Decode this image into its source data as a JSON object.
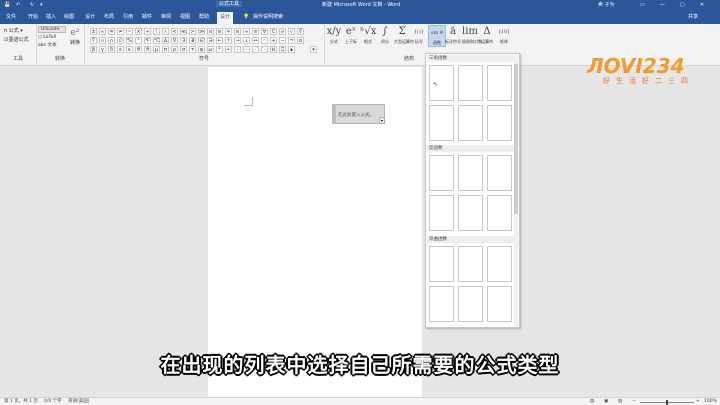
{
  "titlebar": {
    "doc_title": "新建 Microsoft Word 文档 - Word",
    "context_tab": "公式工具",
    "user": "卖 子为"
  },
  "tabs": [
    "文件",
    "开始",
    "插入",
    "绘图",
    "设计",
    "布局",
    "引用",
    "邮件",
    "审阅",
    "视图",
    "帮助",
    "设计"
  ],
  "tell_me": "操作说明搜索",
  "share": "共享",
  "ribbon": {
    "tools": {
      "equation": "公式",
      "ink": "墨迹公式",
      "label": "工具"
    },
    "conversions": {
      "unicode": "Unicode",
      "latex": "LaTeX",
      "text": "abc 文本",
      "convert": "转换",
      "label": "转换"
    },
    "symbols_label": "符号",
    "symbols": [
      "±",
      "∞",
      "=",
      "≠",
      "~",
      "×",
      "÷",
      "!",
      "∝",
      "<",
      "≪",
      ">",
      "≫",
      "≤",
      "≥",
      "∓",
      "≅",
      "≈",
      "≡",
      "∀",
      "∁",
      "∂",
      "√",
      "∛",
      "∜",
      "∪",
      "∩",
      "∅",
      "%",
      "°",
      "℉",
      "℃",
      "∆",
      "∇",
      "∃",
      "∄",
      "∈",
      "∋",
      "←",
      "↑",
      "→",
      "↓",
      "↔",
      "∴",
      "+",
      "−",
      "¬",
      "α",
      "β",
      "γ",
      "δ",
      "ε",
      "ϵ",
      "θ",
      "ϑ",
      "μ",
      "π",
      "ρ",
      "σ",
      "τ",
      "φ",
      "ω",
      "*",
      "∙",
      "⋮",
      "⋯",
      "⋰",
      "⋱",
      "ℵ",
      "ℶ",
      "∎"
    ],
    "structures": [
      {
        "icon": "x/y",
        "label": "分式"
      },
      {
        "icon": "eˣ",
        "label": "上下标"
      },
      {
        "icon": "ⁿ√x",
        "label": "根式"
      },
      {
        "icon": "∫",
        "label": "积分"
      },
      {
        "icon": "Σ",
        "label": "大型运算符"
      },
      {
        "icon": "{()}",
        "label": "括号"
      },
      {
        "icon": "sin θ",
        "label": "函数"
      },
      {
        "icon": "ä",
        "label": "标注符号"
      },
      {
        "icon": "lim",
        "label": "极限和对数"
      },
      {
        "icon": "Δ",
        "label": "运算符"
      },
      {
        "icon": "[10]",
        "label": "矩阵"
      }
    ],
    "structures_label": "结构"
  },
  "gallery": {
    "sections": [
      "三角函数",
      "反函数",
      "双曲函数"
    ]
  },
  "equation_placeholder": "在此处键入公式。",
  "subtitle": "在出现的列表中选择自己所需要的公式类型",
  "status": {
    "page": "第 1 页，共 1 页",
    "words": "0/0 个字",
    "lang": "英语(美国)",
    "zoom": "100%"
  },
  "watermark": {
    "brand": "ЛOVI234",
    "tagline": "好生活好二三四"
  },
  "colors": {
    "brand_blue": "#2b579a",
    "logo_orange": "#f29b2c"
  }
}
